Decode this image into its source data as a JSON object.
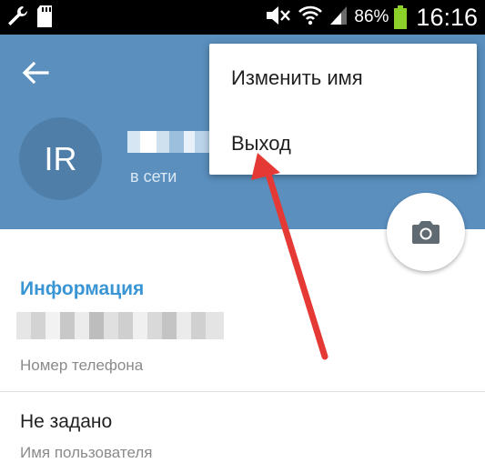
{
  "status_bar": {
    "icons": [
      "wrench-icon",
      "sd-card-icon",
      "mute-icon",
      "wifi-icon",
      "signal-icon",
      "battery-icon"
    ],
    "battery_percent": "86%",
    "time": "16:16",
    "battery_color": "#8bd12a"
  },
  "header": {
    "back_icon": "arrow-left-icon",
    "avatar_initials": "IR",
    "status": "в сети",
    "background_color": "#5a8fbe"
  },
  "menu": {
    "items": [
      {
        "label": "Изменить имя"
      },
      {
        "label": "Выход"
      }
    ]
  },
  "info": {
    "section_title": "Информация",
    "phone_label": "Номер телефона",
    "username_value": "Не задано",
    "username_label": "Имя пользователя",
    "accent_color": "#3a95d5"
  },
  "annotation": {
    "arrow_color": "#e53935"
  }
}
